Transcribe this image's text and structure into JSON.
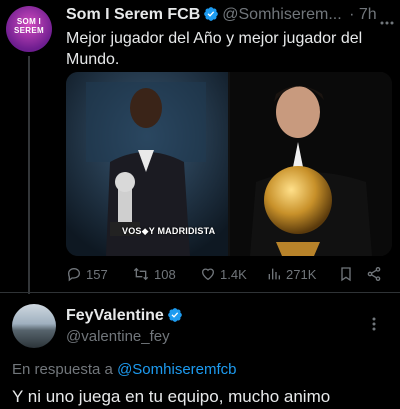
{
  "tweet": {
    "avatar_text": "SOM I SEREM",
    "author_name": "Som I Serem FCB",
    "author_handle": "@Somhiserem...",
    "time": "· 7h",
    "text": "Mejor jugador del Año y mejor jugador del Mundo.",
    "media_caption": "VOS◆Y MADRIDISTA",
    "stats": {
      "replies": "157",
      "retweets": "108",
      "likes": "1.4K",
      "views": "271K"
    }
  },
  "reply": {
    "author_name": "FeyValentine",
    "author_handle": "@valentine_fey",
    "in_reply_prefix": "En respuesta a",
    "in_reply_mention": "@Somhiseremfcb",
    "text": "Y ni uno juega en tu equipo, mucho animo"
  },
  "colors": {
    "background": "#000000",
    "text": "#e7e9ea",
    "muted": "#71767b",
    "accent": "#1d9bf0"
  },
  "icons": [
    "verified-badge-icon",
    "more-icon",
    "reply-icon",
    "retweet-icon",
    "like-icon",
    "views-icon",
    "bookmark-icon",
    "share-icon"
  ]
}
